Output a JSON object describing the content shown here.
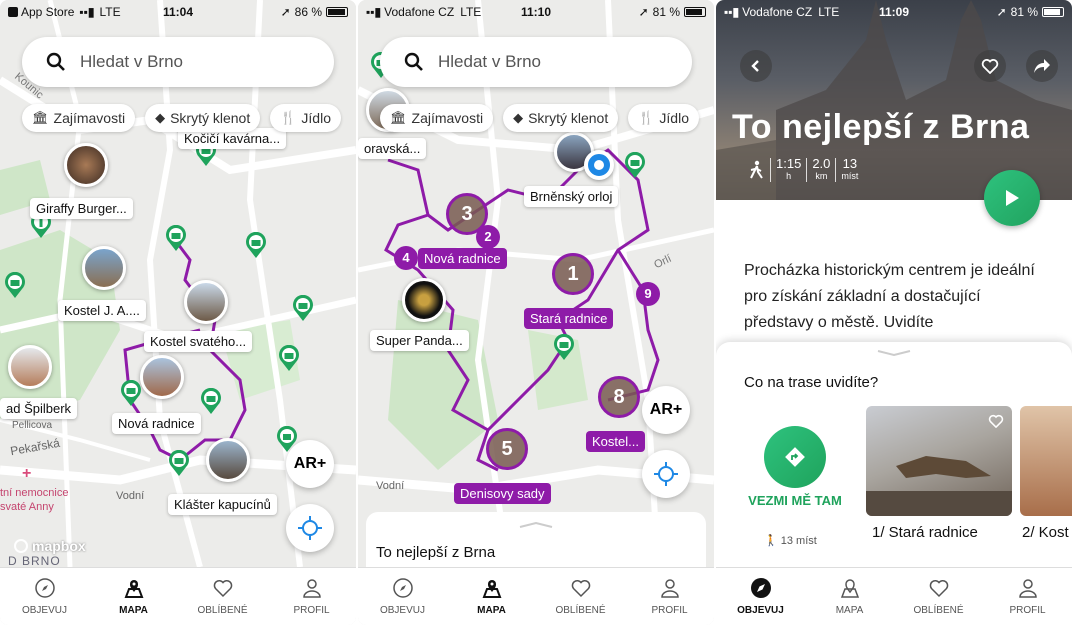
{
  "screen1": {
    "status": {
      "carrier": "App Store",
      "network": "LTE",
      "time": "11:04",
      "battery": "86 %"
    },
    "search_placeholder": "Hledat v Brno",
    "chips": [
      {
        "icon": "landmark-icon",
        "label": "Zajímavosti"
      },
      {
        "icon": "diamond-icon",
        "label": "Skrytý klenot"
      },
      {
        "icon": "cutlery-icon",
        "label": "Jídlo"
      }
    ],
    "map_text": {
      "street1": "Kounic",
      "street2": "Pekařská",
      "street3": "Vodní",
      "street4": "Pellicova",
      "poi": "tní nemocnice\nsvaté Anny"
    },
    "labels": [
      "Kočičí kavárna...",
      "Giraffy Burger...",
      "Kostel J. A....",
      "Kostel svatého...",
      "ad Špilberk",
      "Nová radnice",
      "Klášter kapucínů"
    ],
    "logo_text": "mapbox",
    "city_text": "D BRNO",
    "ar_label": "AR+"
  },
  "screen2": {
    "status": {
      "carrier": "Vodafone CZ",
      "network": "LTE",
      "time": "11:10",
      "battery": "81 %"
    },
    "search_placeholder": "Hledat v Brno",
    "chips": [
      {
        "icon": "landmark-icon",
        "label": "Zajímavosti"
      },
      {
        "icon": "diamond-icon",
        "label": "Skrytý klenot"
      },
      {
        "icon": "cutlery-icon",
        "label": "Jídlo"
      }
    ],
    "map_text": {
      "street1": "Orlí",
      "street2": "Vodní"
    },
    "labels": [
      "oravská...",
      "Brněnský orloj",
      "Super Panda..."
    ],
    "purple_labels": [
      "Nová radnice",
      "Stará radnice",
      "Kostel...",
      "Denisovy sady"
    ],
    "stops": [
      "3",
      "2",
      "4",
      "1",
      "9",
      "8",
      "5"
    ],
    "ar_label": "AR+",
    "sheet_title": "To nejlepší z Brna"
  },
  "screen3": {
    "status": {
      "carrier": "Vodafone CZ",
      "network": "LTE",
      "time": "11:09",
      "battery": "81 %"
    },
    "title": "To nejlepší z Brna",
    "stats": [
      {
        "value": "1:15",
        "unit": "h"
      },
      {
        "value": "2.0",
        "unit": "km"
      },
      {
        "value": "13",
        "unit": "míst"
      }
    ],
    "description": "Procházka historickým centrem je ideální pro získání základní a dostačující představy o městě. Uvidíte",
    "section_title": "Co na trase uvidíte?",
    "go_label": "VEZMI MĚ TAM",
    "go_count": "13 míst",
    "cards": [
      "1/ Stará radnice",
      "2/ Kost"
    ]
  },
  "tabs": [
    {
      "icon": "compass-icon",
      "label": "OBJEVUJ"
    },
    {
      "icon": "map-icon",
      "label": "MAPA"
    },
    {
      "icon": "heart-icon",
      "label": "OBLÍBENÉ"
    },
    {
      "icon": "profile-icon",
      "label": "PROFIL"
    }
  ],
  "colors": {
    "route": "#8e1ba8",
    "pin": "#1fa35c",
    "accent": "#2ec27e"
  }
}
